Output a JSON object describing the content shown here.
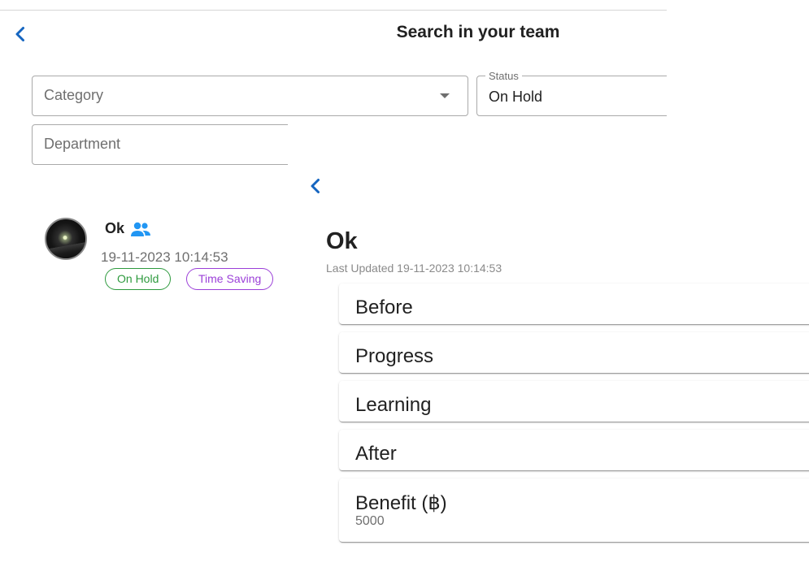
{
  "header": {
    "title": "Search in your team"
  },
  "filters": {
    "category": {
      "placeholder": "Category",
      "value": ""
    },
    "status": {
      "label": "Status",
      "value": "On Hold"
    },
    "department": {
      "placeholder": "Department",
      "value": ""
    }
  },
  "list": {
    "items": [
      {
        "title": "Ok",
        "date": "19-11-2023 10:14:53",
        "status_chip": "On Hold",
        "type_chip": "Time Saving"
      }
    ]
  },
  "detail": {
    "title": "Ok",
    "last_updated": "Last Updated 19-11-2023 10:14:53",
    "sections": [
      {
        "label": "Before"
      },
      {
        "label": "Progress"
      },
      {
        "label": "Learning"
      },
      {
        "label": "After"
      },
      {
        "label": "Benefit (฿)",
        "value": "5000"
      }
    ]
  },
  "colors": {
    "accent": "#1565c0",
    "group_icon": "#2196f3",
    "status_chip": "#2e9a3e",
    "type_chip": "#9b3fd8"
  },
  "icons": {
    "back": "chevron-left-icon",
    "dropdown": "arrow-drop-down-icon",
    "group": "group-icon"
  }
}
